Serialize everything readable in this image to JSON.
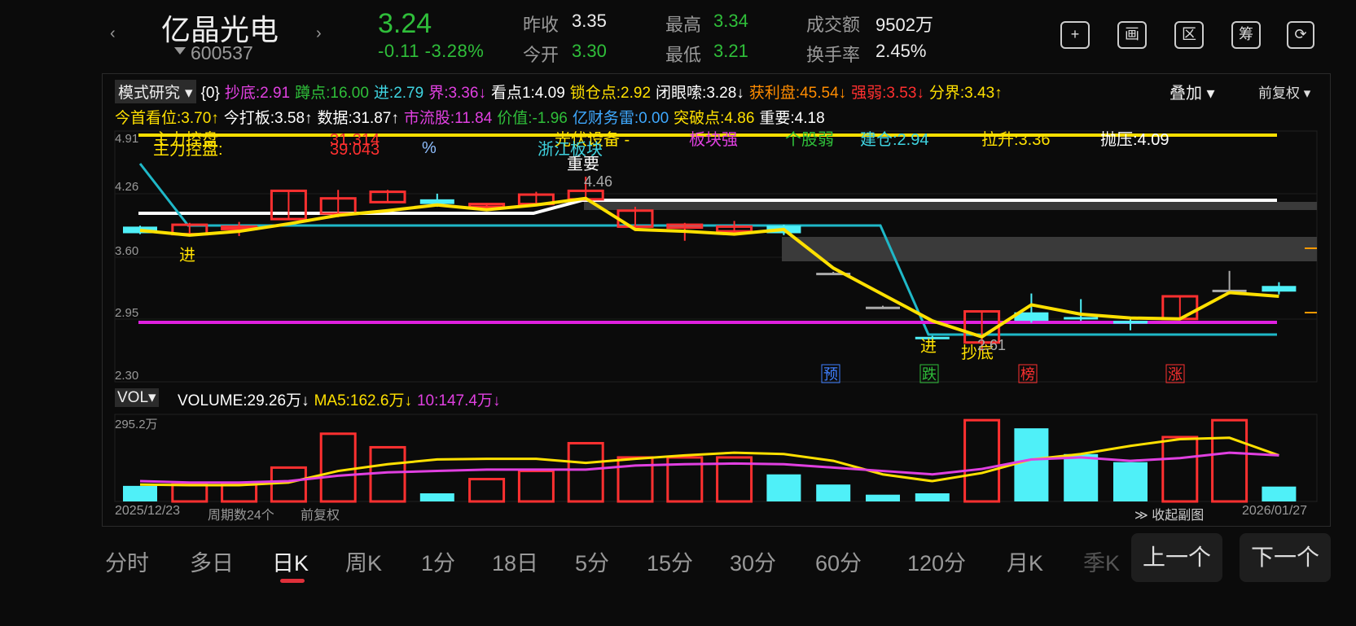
{
  "header": {
    "prev_arrow": "‹",
    "next_arrow": "›",
    "stock_name": "亿晶光电",
    "stock_code": "600537",
    "price": "3.24",
    "change": "-0.11 -3.28%",
    "quotes": [
      {
        "label": "昨收",
        "value": "3.35",
        "green": false
      },
      {
        "label": "今开",
        "value": "3.30",
        "green": true
      },
      {
        "label": "最高",
        "value": "3.34",
        "green": true
      },
      {
        "label": "最低",
        "value": "3.21",
        "green": true
      },
      {
        "label": "成交额",
        "value": "9502万",
        "green": false
      },
      {
        "label": "换手率",
        "value": "2.45%",
        "green": false
      }
    ],
    "buttons": [
      {
        "name": "add-icon",
        "glyph": "+"
      },
      {
        "name": "chart-icon",
        "glyph": "画"
      },
      {
        "name": "range-icon",
        "glyph": "区"
      },
      {
        "name": "chips-icon",
        "glyph": "筹"
      },
      {
        "name": "rotate-screen-icon",
        "glyph": "⟳"
      }
    ]
  },
  "indicators": {
    "mode_label": "模式研究",
    "line1": [
      {
        "text": "{0}",
        "color": "#ffffff"
      },
      {
        "text": "抄底:2.91",
        "color": "#e040e0"
      },
      {
        "text": "蹲点:16.00",
        "color": "#2fbf3a"
      },
      {
        "text": "进:2.79",
        "color": "#3fd3e0"
      },
      {
        "text": "界:3.36↓",
        "color": "#e040e0"
      },
      {
        "text": "看点1:4.09",
        "color": "#ffffff"
      },
      {
        "text": "锁仓点:2.92",
        "color": "#ffe000"
      },
      {
        "text": "闭眼嗦:3.28↓",
        "color": "#ffffff"
      },
      {
        "text": "获利盘:45.54↓",
        "color": "#ff8c00"
      },
      {
        "text": "强弱:3.53↓",
        "color": "#ff3030"
      },
      {
        "text": "分界:3.43↑",
        "color": "#ffe000"
      }
    ],
    "line2": [
      {
        "text": "今首看位:3.70↑",
        "color": "#ffe000"
      },
      {
        "text": "今打板:3.58↑",
        "color": "#ffffff"
      },
      {
        "text": "数据:31.87↑",
        "color": "#ffffff"
      },
      {
        "text": "市流股:11.84",
        "color": "#e040e0"
      },
      {
        "text": "价值:-1.96",
        "color": "#2fbf3a"
      },
      {
        "text": "亿财务雷:0.00",
        "color": "#3fa9ff"
      },
      {
        "text": "突破点:4.86",
        "color": "#ffe000"
      },
      {
        "text": "重要:4.18",
        "color": "#ffffff"
      }
    ],
    "overlay_label": "叠加",
    "fq_label": "前复权"
  },
  "price_axis": [
    "4.91",
    "4.26",
    "3.60",
    "2.95",
    "2.30"
  ],
  "chart_labels": {
    "main_control": "主力控盘:",
    "main_control_over": "主力控盘",
    "v1": "39.043",
    "v1_over": "31.314",
    "pct": "%",
    "region": "浙江板块",
    "sector": "光伏设备 -",
    "important": "重要",
    "peak": "4.46",
    "block_strong": "板块强",
    "stock_weak": "个股弱",
    "build": "建仓:2.94",
    "pull": "拉升:3.36",
    "press": "抛压:4.09",
    "enter1": "进",
    "enter2": "进",
    "bottom_pick": "抄底",
    "low": "2.61",
    "signals": [
      {
        "text": "预",
        "color": "#3f7fff"
      },
      {
        "text": "跌",
        "color": "#2fbf3a"
      },
      {
        "text": "榜",
        "color": "#ff3030"
      },
      {
        "text": "涨",
        "color": "#ff3030"
      }
    ]
  },
  "volume": {
    "box_label": "VOL",
    "items": [
      {
        "text": "VOLUME:29.26万↓",
        "color": "#ffffff"
      },
      {
        "text": "MA5:162.6万↓",
        "color": "#ffe000"
      },
      {
        "text": "10:147.4万↓",
        "color": "#e040e0"
      }
    ],
    "max_label": "295.2万"
  },
  "footer_meta": {
    "start_date": "2025/12/23",
    "period_count": "周期数24个",
    "fq": "前复权",
    "collapse": "收起副图",
    "end_date": "2026/01/27"
  },
  "tabs": [
    "分时",
    "多日",
    "日K",
    "周K",
    "1分",
    "18日",
    "5分",
    "15分",
    "30分",
    "60分",
    "120分",
    "月K",
    "季K"
  ],
  "active_tab": "日K",
  "nav": {
    "prev": "上一个",
    "next": "下一个"
  },
  "chart_data": {
    "type": "candlestick",
    "dates": [
      "2025/12/23",
      "",
      "",
      "",
      "",
      "",
      "",
      "",
      "",
      "",
      "",
      "",
      "",
      "",
      "",
      "",
      "",
      "",
      "",
      "",
      "",
      "",
      "",
      "2026/01/27"
    ],
    "ylim": [
      2.3,
      4.91
    ],
    "candles": [
      {
        "o": 3.93,
        "c": 3.86,
        "h": 3.94,
        "l": 3.85,
        "dir": "down"
      },
      {
        "o": 3.85,
        "c": 3.95,
        "h": 3.97,
        "l": 3.83,
        "dir": "up"
      },
      {
        "o": 3.92,
        "c": 3.93,
        "h": 3.98,
        "l": 3.83,
        "dir": "up"
      },
      {
        "o": 4.01,
        "c": 4.31,
        "h": 4.31,
        "l": 4.01,
        "dir": "up"
      },
      {
        "o": 4.07,
        "c": 4.23,
        "h": 4.32,
        "l": 4.03,
        "dir": "up"
      },
      {
        "o": 4.19,
        "c": 4.3,
        "h": 4.32,
        "l": 4.18,
        "dir": "up"
      },
      {
        "o": 4.17,
        "c": 4.22,
        "h": 4.28,
        "l": 4.14,
        "dir": "down"
      },
      {
        "o": 4.14,
        "c": 4.17,
        "h": 4.18,
        "l": 4.12,
        "dir": "up"
      },
      {
        "o": 4.17,
        "c": 4.27,
        "h": 4.3,
        "l": 4.15,
        "dir": "up"
      },
      {
        "o": 4.22,
        "c": 4.31,
        "h": 4.46,
        "l": 4.22,
        "dir": "up"
      },
      {
        "o": 3.93,
        "c": 4.1,
        "h": 4.14,
        "l": 3.93,
        "dir": "up"
      },
      {
        "o": 3.92,
        "c": 3.95,
        "h": 3.97,
        "l": 3.78,
        "dir": "up"
      },
      {
        "o": 3.88,
        "c": 3.93,
        "h": 3.99,
        "l": 3.86,
        "dir": "up"
      },
      {
        "o": 3.94,
        "c": 3.86,
        "h": 3.95,
        "l": 3.84,
        "dir": "down"
      },
      {
        "o": 3.44,
        "c": 3.44,
        "h": 3.45,
        "l": 3.43,
        "dir": "flat"
      },
      {
        "o": 3.08,
        "c": 3.08,
        "h": 3.09,
        "l": 3.07,
        "dir": "flat"
      },
      {
        "o": 2.76,
        "c": 2.74,
        "h": 2.77,
        "l": 2.73,
        "dir": "down"
      },
      {
        "o": 2.7,
        "c": 3.03,
        "h": 3.03,
        "l": 2.61,
        "dir": "up"
      },
      {
        "o": 3.02,
        "c": 2.93,
        "h": 3.22,
        "l": 2.91,
        "dir": "down"
      },
      {
        "o": 2.97,
        "c": 2.95,
        "h": 3.16,
        "l": 2.93,
        "dir": "down"
      },
      {
        "o": 2.93,
        "c": 2.9,
        "h": 2.97,
        "l": 2.83,
        "dir": "down"
      },
      {
        "o": 2.95,
        "c": 3.19,
        "h": 3.19,
        "l": 2.95,
        "dir": "up"
      },
      {
        "o": 3.26,
        "c": 3.26,
        "h": 3.46,
        "l": 3.21,
        "dir": "flat"
      },
      {
        "o": 3.3,
        "c": 3.24,
        "h": 3.34,
        "l": 3.21,
        "dir": "down"
      }
    ],
    "yellow_line": [
      3.89,
      3.84,
      3.88,
      3.96,
      4.05,
      4.1,
      4.16,
      4.11,
      4.16,
      4.23,
      3.9,
      3.88,
      3.85,
      3.9,
      3.49,
      3.21,
      2.93,
      2.76,
      3.1,
      3.0,
      2.96,
      2.95,
      3.23,
      3.19
    ],
    "volume_values": [
      23,
      25,
      25,
      50,
      100,
      80,
      12,
      33,
      45,
      86,
      65,
      65,
      65,
      40,
      25,
      10,
      12,
      120,
      108,
      70,
      58,
      95,
      120,
      22
    ],
    "volume_dir": [
      "down",
      "up",
      "up",
      "up",
      "up",
      "up",
      "down",
      "up",
      "up",
      "up",
      "up",
      "up",
      "up",
      "down",
      "down",
      "down",
      "down",
      "up",
      "down",
      "down",
      "down",
      "up",
      "up",
      "down"
    ],
    "ma5": [
      25,
      24,
      24,
      28,
      45,
      55,
      62,
      63,
      63,
      57,
      63,
      68,
      72,
      70,
      60,
      40,
      30,
      42,
      62,
      70,
      82,
      92,
      94,
      68
    ],
    "ma10": [
      30,
      28,
      28,
      30,
      38,
      43,
      45,
      47,
      47,
      47,
      53,
      55,
      56,
      55,
      50,
      45,
      40,
      48,
      62,
      65,
      60,
      64,
      72,
      68
    ]
  }
}
